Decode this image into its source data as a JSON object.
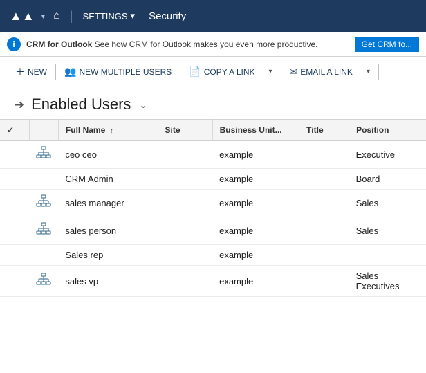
{
  "nav": {
    "logo": "▲▲",
    "home_icon": "⌂",
    "settings_label": "SETTINGS",
    "settings_chevron": "▾",
    "security_label": "Security"
  },
  "banner": {
    "icon": "i",
    "app_name": "CRM for Outlook",
    "message": " See how CRM for Outlook makes you even more productive.",
    "get_btn": "Get CRM fo..."
  },
  "toolbar": {
    "new_label": "NEW",
    "new_multiple_label": "NEW MULTIPLE USERS",
    "copy_link_label": "COPY A LINK",
    "email_link_label": "EMAIL A LINK"
  },
  "page": {
    "title": "Enabled Users",
    "title_chevron": "⌄"
  },
  "table": {
    "columns": [
      {
        "key": "check",
        "label": "✓",
        "sortable": false
      },
      {
        "key": "icon",
        "label": "",
        "sortable": false
      },
      {
        "key": "fullname",
        "label": "Full Name",
        "sortable": true,
        "sort_dir": "asc"
      },
      {
        "key": "site",
        "label": "Site",
        "sortable": false
      },
      {
        "key": "bu",
        "label": "Business Unit...",
        "sortable": false
      },
      {
        "key": "title",
        "label": "Title",
        "sortable": false
      },
      {
        "key": "position",
        "label": "Position",
        "sortable": false
      }
    ],
    "rows": [
      {
        "has_icon": true,
        "fullname": "ceo ceo",
        "site": "",
        "bu": "example",
        "title": "",
        "position": "Executive"
      },
      {
        "has_icon": false,
        "fullname": "CRM Admin",
        "site": "",
        "bu": "example",
        "title": "",
        "position": "Board"
      },
      {
        "has_icon": true,
        "fullname": "sales manager",
        "site": "",
        "bu": "example",
        "title": "",
        "position": "Sales"
      },
      {
        "has_icon": true,
        "fullname": "sales person",
        "site": "",
        "bu": "example",
        "title": "",
        "position": "Sales"
      },
      {
        "has_icon": false,
        "fullname": "Sales rep",
        "site": "",
        "bu": "example",
        "title": "",
        "position": ""
      },
      {
        "has_icon": true,
        "fullname": "sales vp",
        "site": "",
        "bu": "example",
        "title": "",
        "position": "Sales Executives"
      }
    ]
  }
}
